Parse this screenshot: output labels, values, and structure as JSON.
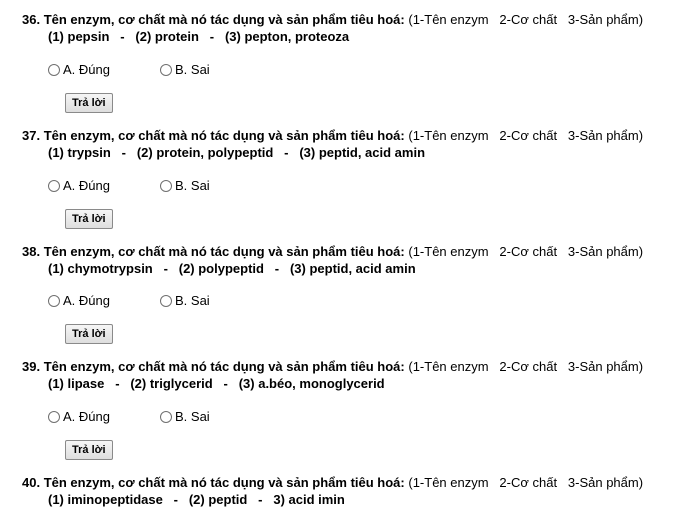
{
  "questions": [
    {
      "number": "36.",
      "stem": "Tên enzym, cơ chất mà nó tác dụng và sản phẩm tiêu hoá:",
      "hint": "(1-Tên enzym   2-Cơ chất   3-Sản phẩm)",
      "answer_line": "(1) pepsin   -   (2) protein   -   (3) pepton, proteoza",
      "option_a": "A. Đúng",
      "option_b": "B. Sai",
      "submit_label": "Trả lời"
    },
    {
      "number": "37.",
      "stem": "Tên enzym, cơ chất mà nó tác dụng và sản phẩm tiêu hoá:",
      "hint": "(1-Tên enzym   2-Cơ chất   3-Sản phẩm)",
      "answer_line": "(1) trypsin   -   (2) protein, polypeptid   -   (3) peptid, acid amin",
      "option_a": "A. Đúng",
      "option_b": "B. Sai",
      "submit_label": "Trả lời"
    },
    {
      "number": "38.",
      "stem": "Tên enzym, cơ chất mà nó tác dụng và sản phẩm tiêu hoá:",
      "hint": "(1-Tên enzym   2-Cơ chất   3-Sản phẩm)",
      "answer_line": "(1) chymotrypsin   -   (2) polypeptid   -   (3) peptid, acid amin",
      "option_a": "A. Đúng",
      "option_b": "B. Sai",
      "submit_label": "Trả lời"
    },
    {
      "number": "39.",
      "stem": "Tên enzym, cơ chất mà nó tác dụng và sản phẩm tiêu hoá:",
      "hint": "(1-Tên enzym   2-Cơ chất   3-Sản phẩm)",
      "answer_line": "(1) lipase   -   (2) triglycerid   -   (3) a.béo, monoglycerid",
      "option_a": "A. Đúng",
      "option_b": "B. Sai",
      "submit_label": "Trả lời"
    },
    {
      "number": "40.",
      "stem": "Tên enzym, cơ chất mà nó tác dụng và sản phẩm tiêu hoá:",
      "hint": "(1-Tên enzym   2-Cơ chất   3-Sản phẩm)",
      "answer_line": "(1) iminopeptidase   -   (2) peptid   -   3) acid imin"
    }
  ]
}
